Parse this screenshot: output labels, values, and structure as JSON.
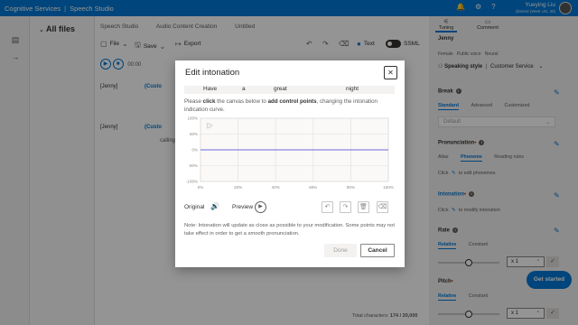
{
  "topbar": {
    "service": "Cognitive Services",
    "product": "Speech Studio",
    "user_name": "Yueying Liu",
    "user_region": "(limited (West US, 30)"
  },
  "file_pane": {
    "title": "All files"
  },
  "breadcrumb": [
    "Speech Studio",
    "Audio Content Creation",
    "Untitled"
  ],
  "toolbar": {
    "file": "File",
    "save": "Save",
    "export": "Export",
    "text": "Text",
    "ssml": "SSML"
  },
  "player": {
    "time": "00:00"
  },
  "editor": {
    "line1_voice": "[Jenny]",
    "line1_tag": "(Custo",
    "line2_voice": "[Jenny]",
    "line2_tag": "(Custo",
    "line2_text": "calling"
  },
  "status": {
    "total_chars_label": "Total characters:",
    "total_chars_value": "174 / 20,000"
  },
  "right_pane": {
    "tab_tuning": "Tuning",
    "tab_comment": "Comment",
    "voice_name": "Jenny",
    "voice_tags": [
      "Female",
      "Public voice",
      "Neural"
    ],
    "speaking_style_label": "Speaking style",
    "speaking_style_value": "Customer Service",
    "break_title": "Break",
    "break_tabs": [
      "Standard",
      "Advanced",
      "Customized"
    ],
    "break_default": "Default",
    "pronunciation_title": "Pronunciation",
    "pronunciation_tabs": [
      "Alias",
      "Phoneme",
      "Reading rules"
    ],
    "pronunciation_hint_a": "Click",
    "pronunciation_hint_b": "to edit phonemes",
    "intonation_title": "Intonation",
    "intonation_hint_a": "Click",
    "intonation_hint_b": "to modify intonation",
    "rate_title": "Rate",
    "rate_tabs": [
      "Relative",
      "Constant"
    ],
    "rate_value": "x 1",
    "rate_level": 0.5,
    "pitch_title": "Pitch",
    "pitch_tabs": [
      "Relative",
      "Constant"
    ],
    "pitch_value": "x 1",
    "pitch_level": 0.5,
    "get_started": "Get started"
  },
  "dialog": {
    "title": "Edit intonation",
    "words": [
      "Have",
      "a",
      "great",
      "night"
    ],
    "instr_prefix": "Please",
    "instr_click": "click",
    "instr_mid": "the canvas below to",
    "instr_add": "add control points",
    "instr_suffix": ", changing the intonation indication curve.",
    "original_label": "Original",
    "preview_label": "Preview",
    "note": "Note: Intonation will update as close as possible to your modification. Some points may not take effect in order to get a smooth pronunciation.",
    "done_label": "Done",
    "cancel_label": "Cancel"
  },
  "chart_data": {
    "type": "line",
    "x_tick_labels": [
      "0%",
      "20%",
      "40%",
      "60%",
      "80%",
      "100%"
    ],
    "y_tick_labels": [
      "100%",
      "50%",
      "0%",
      "-50%",
      "-100%"
    ],
    "xlim": [
      0,
      100
    ],
    "ylim": [
      -100,
      100
    ],
    "grid": true,
    "series": [
      {
        "x": [
          0,
          100
        ],
        "y": [
          0,
          0
        ],
        "color": "#6b69d6"
      }
    ]
  }
}
